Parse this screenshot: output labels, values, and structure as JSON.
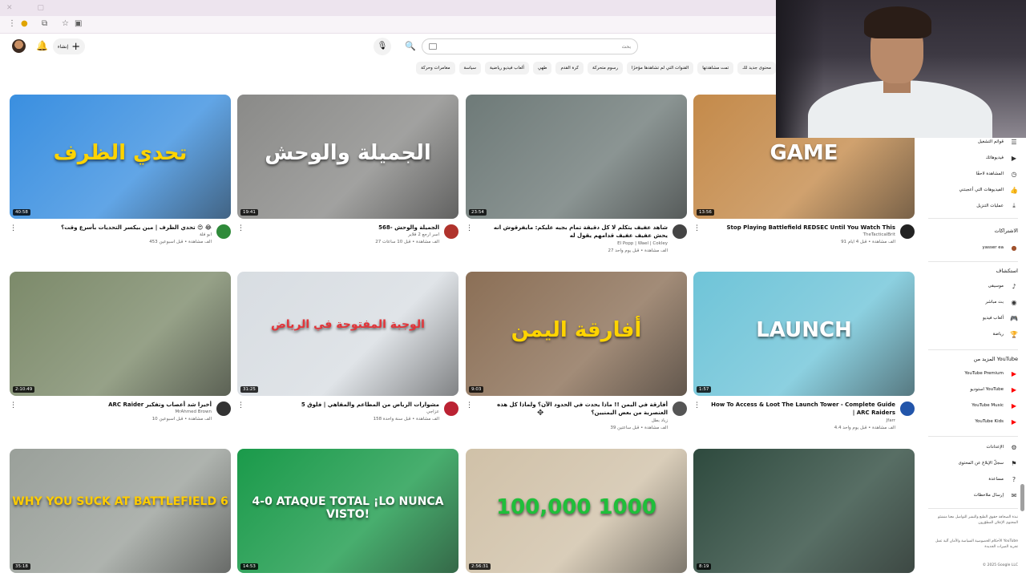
{
  "header": {
    "create_label": "إنشاء",
    "search_placeholder": "بحث"
  },
  "chips": [
    "محتوى جديد لك",
    "تمت مشاهدتها",
    "القنوات التي لم تشاهدها مؤخرًا",
    "رسوم متحركة",
    "كرة القدم",
    "طهي",
    "ألعاب فيديو رياضية",
    "سياسة",
    "مغامرات وحركة"
  ],
  "videos": [
    {
      "duration": "40:58",
      "title": "تحدي الظرف | مين بيكسر التحديات بأسرع وقت؟ 😍 😂",
      "channel": "ابو فلة",
      "stats": "453 ألف مشاهدة • قبل أسبوعين",
      "thumb_text": "تحدي الظرف",
      "bg": "#3a8fe0",
      "accent": "#ffd400"
    },
    {
      "duration": "19:41",
      "title": "568- الجميلة والوحش",
      "channel": "أسر ارجع 2 فلاير",
      "stats": "27 ألف مشاهدة • قبل 10 ساعات",
      "thumb_text": "الجميلة والوحش",
      "bg": "#8a8a88",
      "accent": "#ffffff"
    },
    {
      "duration": "23:54",
      "title": "شاهد عفيف يتكلم لا كل دقيقة تمام بجيه عليكم: مايفرقوش انه يحش عفيف عفيف قدامهم يقول له",
      "channel": "El Popp | Wael | Cokley",
      "stats": "27 ألف مشاهدة • قبل يوم واحد",
      "thumb_text": "",
      "bg": "#6e7a78",
      "accent": "#ffffff"
    },
    {
      "duration": "13:56",
      "title": "Stop Playing Battlefield REDSEC Until You Watch This",
      "channel": "TheTacticalBrit",
      "stats": "91 ألف مشاهدة • قبل 4 أيام",
      "thumb_text": "GAME",
      "bg": "#c48a4a",
      "accent": "#ffffff"
    },
    {
      "duration": "2:10:49",
      "title": "ARC Raider أخيرا شد أعصاب وتفكير",
      "channel": "MrAhmed Brown",
      "stats": "10 ألف مشاهدة • قبل أسبوعين",
      "thumb_text": "",
      "bg": "#7c8a6a",
      "accent": "#ffffff"
    },
    {
      "duration": "31:25",
      "title": "مشوارات الرياض من المطاعم والمقاهي | فلوق 5",
      "channel": "عزاجي",
      "stats": "158 ألف مشاهدة • قبل سنة واحدة",
      "thumb_text": "الوجبة المفتوحة في الرياض",
      "bg": "#d8dde2",
      "accent": "#e2353a"
    },
    {
      "duration": "9:03",
      "title": "أفارقة في اليمن !! ماذا يحدث في الحدود الآن؟ ولماذا كل هذه العنصرية من بعض اليمنيين؟",
      "channel": "زياد بطل",
      "stats": "39 ألف مشاهدة • قبل ساعتين",
      "thumb_text": "أفارقة اليمن",
      "bg": "#8b6f56",
      "accent": "#ffd400"
    },
    {
      "duration": "1:57",
      "title": "How To Access & Loot The Launch Tower - Complete Guide | ARC Raiders",
      "channel": "Jfarr",
      "stats": "4.4 ألف مشاهدة • قبل يوم واحد",
      "thumb_text": "LAUNCH",
      "bg": "#6fc4d8",
      "accent": "#ffffff"
    },
    {
      "duration": "35:18",
      "title": "",
      "channel": "",
      "stats": "",
      "thumb_text": "WHY YOU SUCK AT BATTLEFIELD 6",
      "bg": "#9aa09a",
      "accent": "#ffcc00"
    },
    {
      "duration": "14:53",
      "title": "",
      "channel": "",
      "stats": "",
      "thumb_text": "4-0 ATAQUE TOTAL ¡LO NUNCA VISTO!",
      "bg": "#1a9a4a",
      "accent": "#ffffff"
    },
    {
      "duration": "2:56:31",
      "title": "",
      "channel": "",
      "stats": "",
      "thumb_text": "100,000 1000",
      "bg": "#d0c1a8",
      "accent": "#1fbf3a"
    },
    {
      "duration": "8:19",
      "title": "",
      "channel": "",
      "stats": "",
      "thumb_text": "",
      "bg": "#2e4a3e",
      "accent": "#ffffff"
    }
  ],
  "sidebar": {
    "you_items": [
      {
        "label": "قوائم التشغيل",
        "icon": "playlist-icon"
      },
      {
        "label": "فيديوهاتك",
        "icon": "video-icon"
      },
      {
        "label": "المشاهدة لاحقًا",
        "icon": "clock-icon"
      },
      {
        "label": "الفيديوهات التي أعجبتني",
        "icon": "like-icon"
      },
      {
        "label": "عمليات التنزيل",
        "icon": "download-icon"
      }
    ],
    "subscriptions_heading": "الاشتراكات",
    "subscription_item": "yasser ea",
    "explore_heading": "استكشاف",
    "explore_items": [
      {
        "label": "موسيقى",
        "icon": "music-icon"
      },
      {
        "label": "بث مباشر",
        "icon": "live-icon"
      },
      {
        "label": "ألعاب فيديو",
        "icon": "gaming-icon"
      },
      {
        "label": "رياضة",
        "icon": "trophy-icon"
      }
    ],
    "more_heading": "المزيد من YouTube",
    "more_items": [
      "YouTube Premium",
      "استوديو YouTube",
      "YouTube Music",
      "YouTube Kids"
    ],
    "settings_items": [
      {
        "label": "الإعدادات",
        "icon": "gear-icon"
      },
      {
        "label": "سجلّ الإبلاغ عن المحتوى",
        "icon": "flag-icon"
      },
      {
        "label": "مساعدة",
        "icon": "help-icon"
      },
      {
        "label": "إرسال ملاحظات",
        "icon": "feedback-icon"
      }
    ],
    "footer_1": "نبذة  الصحافة  حقوق الطبع والنشر  التواصل معنا  منشئو المحتوى  الإعلان  المطوّرون",
    "footer_2": "الأحكام  الخصوصية  السياسة والأمان  آلية عمل YouTube  تجربة الميزات الجديدة",
    "copyright": "© 2025 Google LLC"
  }
}
